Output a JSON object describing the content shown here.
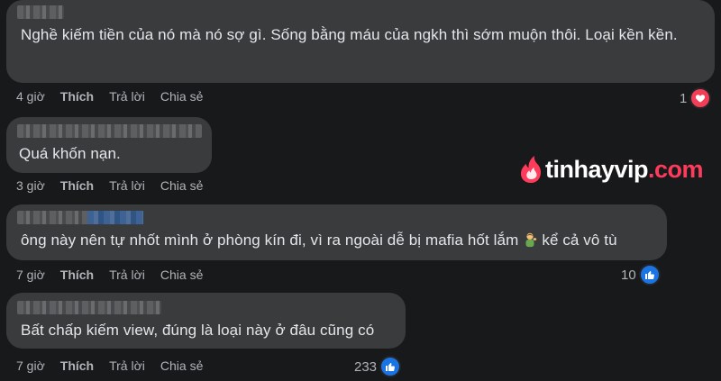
{
  "comments": [
    {
      "text": "Nghề kiếm tiền của nó mà nó sợ gì. Sống bằng máu của ngkh thì sớm muộn thôi. Loại kền kền.",
      "time": "4 giờ",
      "like": "Thích",
      "reply": "Trả lời",
      "share": "Chia sẻ",
      "reaction_count": "1",
      "reaction_icon": "heart-icon"
    },
    {
      "text": "Quá khốn nạn.",
      "time": "3 giờ",
      "like": "Thích",
      "reply": "Trả lời",
      "share": "Chia sẻ"
    },
    {
      "text_before": "ông này nên tự nhốt mình ở phòng kín đi, vì ra ngoài dễ bị mafia hốt lắm",
      "emoji": "man-gesturing-icon",
      "text_after": "kể cả vô tù",
      "time": "7 giờ",
      "like": "Thích",
      "reply": "Trả lời",
      "share": "Chia sẻ",
      "reaction_count": "10",
      "reaction_icon": "thumbs-up-icon"
    },
    {
      "text": "Bất chấp kiếm view, đúng là loại này ở đâu cũng có",
      "time": "7 giờ",
      "like": "Thích",
      "reply": "Trả lời",
      "share": "Chia sẻ",
      "reaction_count": "233",
      "reaction_icon": "thumbs-up-icon"
    }
  ],
  "watermark": {
    "name": "tinhayvip",
    "suffix": ".com"
  },
  "colors": {
    "background": "#18191a",
    "bubble": "#3a3b3c",
    "text": "#e4e6eb",
    "meta": "#b0b3b8",
    "like_blue": "#1b74e4",
    "heart_red": "#f33e58",
    "brand_pink": "#ff3b5c"
  }
}
